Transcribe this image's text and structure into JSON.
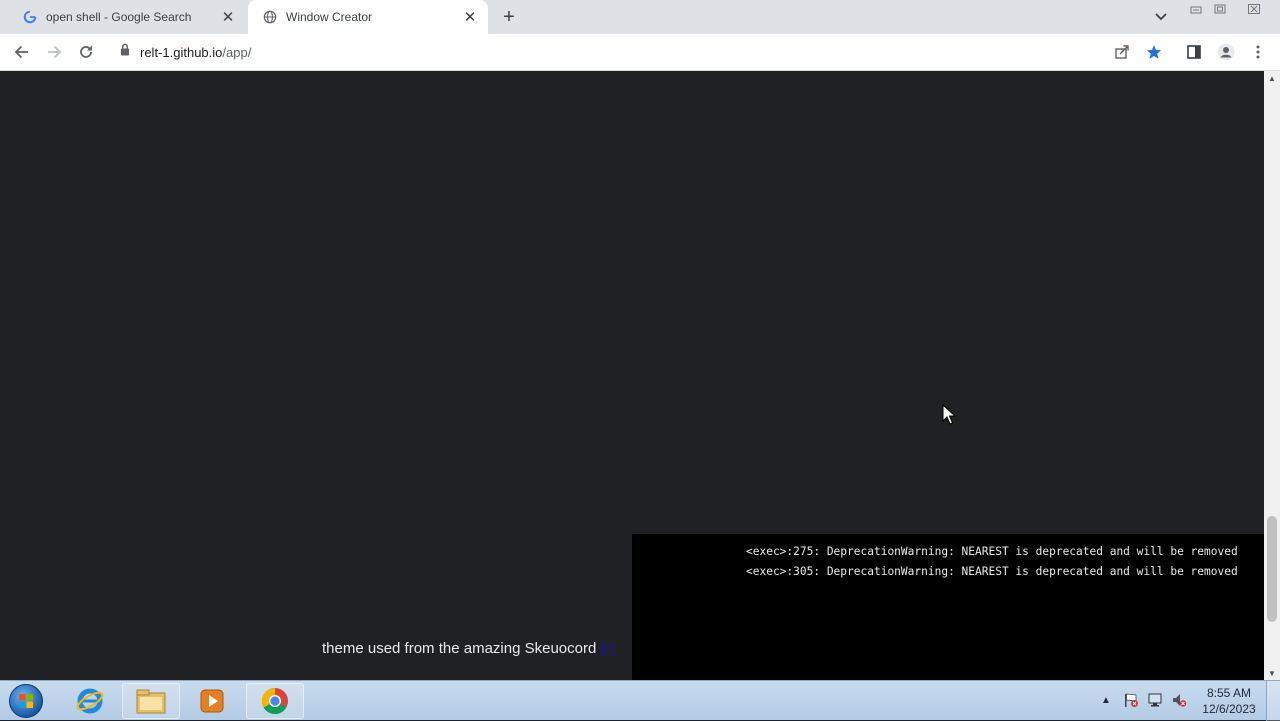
{
  "browser": {
    "tabs": [
      {
        "title": "open shell - Google Search",
        "favicon": "google-g-icon",
        "active": false
      },
      {
        "title": "Window Creator",
        "favicon": "globe-icon",
        "active": true
      }
    ],
    "address": {
      "host": "relt-1.github.io",
      "path": "/app/"
    }
  },
  "terminal": {
    "lines": [
      "<exec>:275: DeprecationWarning: NEAREST is deprecated and will be removed",
      "<exec>:305: DeprecationWarning: NEAREST is deprecated and will be removed"
    ]
  },
  "credit": {
    "text": "theme used from the amazing Skeuocord",
    "link_text": "(r)"
  },
  "taskbar": {
    "apps": [
      "internet-explorer-icon",
      "file-explorer-icon",
      "media-player-icon",
      "chrome-icon"
    ],
    "clock": {
      "time": "8:55 AM",
      "date": "12/6/2023"
    }
  },
  "colors": {
    "page_bg": "#202124",
    "terminal_bg": "#000000",
    "tabstrip_bg": "#dee1e6",
    "star_blue": "#1a73e8"
  }
}
